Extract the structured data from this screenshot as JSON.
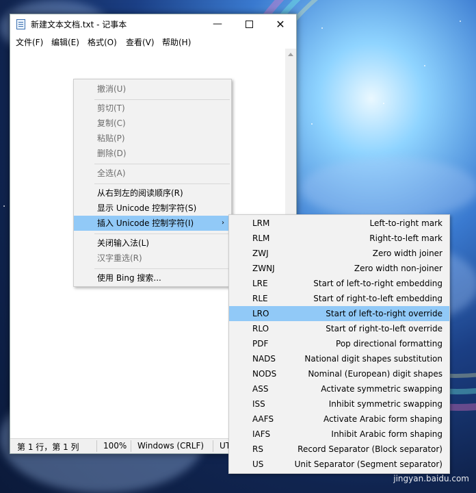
{
  "window": {
    "title": "新建文本文档.txt - 记事本",
    "controls": {
      "minimize": "—",
      "close": "✕"
    }
  },
  "menubar": [
    "文件(F)",
    "编辑(E)",
    "格式(O)",
    "查看(V)",
    "帮助(H)"
  ],
  "statusbar": {
    "position": "第 1 行，第 1 列",
    "zoom": "100%",
    "line_ending": "Windows (CRLF)",
    "encoding": "UT"
  },
  "context_menu": {
    "items": [
      {
        "label": "撤消(U)"
      },
      {
        "label": "剪切(T)"
      },
      {
        "label": "复制(C)"
      },
      {
        "label": "粘贴(P)"
      },
      {
        "label": "删除(D)"
      },
      {
        "label": "全选(A)"
      },
      {
        "label": "从右到左的阅读顺序(R)"
      },
      {
        "label": "显示 Unicode 控制字符(S)"
      },
      {
        "label": "插入 Unicode 控制字符(I)"
      },
      {
        "label": "关闭输入法(L)"
      },
      {
        "label": "汉字重选(R)"
      },
      {
        "label": "使用 Bing 搜索..."
      }
    ],
    "submenu_arrow": "›"
  },
  "submenu": {
    "items": [
      {
        "code": "LRM",
        "desc": "Left-to-right mark"
      },
      {
        "code": "RLM",
        "desc": "Right-to-left mark"
      },
      {
        "code": "ZWJ",
        "desc": "Zero width joiner"
      },
      {
        "code": "ZWNJ",
        "desc": "Zero width non-joiner"
      },
      {
        "code": "LRE",
        "desc": "Start of left-to-right embedding"
      },
      {
        "code": "RLE",
        "desc": "Start of right-to-left embedding"
      },
      {
        "code": "LRO",
        "desc": "Start of left-to-right override"
      },
      {
        "code": "RLO",
        "desc": "Start of right-to-left override"
      },
      {
        "code": "PDF",
        "desc": "Pop directional formatting"
      },
      {
        "code": "NADS",
        "desc": "National digit shapes substitution"
      },
      {
        "code": "NODS",
        "desc": "Nominal (European) digit shapes"
      },
      {
        "code": "ASS",
        "desc": "Activate symmetric swapping"
      },
      {
        "code": "ISS",
        "desc": "Inhibit symmetric swapping"
      },
      {
        "code": "AAFS",
        "desc": "Activate Arabic form shaping"
      },
      {
        "code": "IAFS",
        "desc": "Inhibit Arabic form shaping"
      },
      {
        "code": "RS",
        "desc": "Record Separator (Block separator)"
      },
      {
        "code": "US",
        "desc": "Unit Separator (Segment separator)"
      }
    ]
  },
  "watermark": "jingyan.baidu.com"
}
